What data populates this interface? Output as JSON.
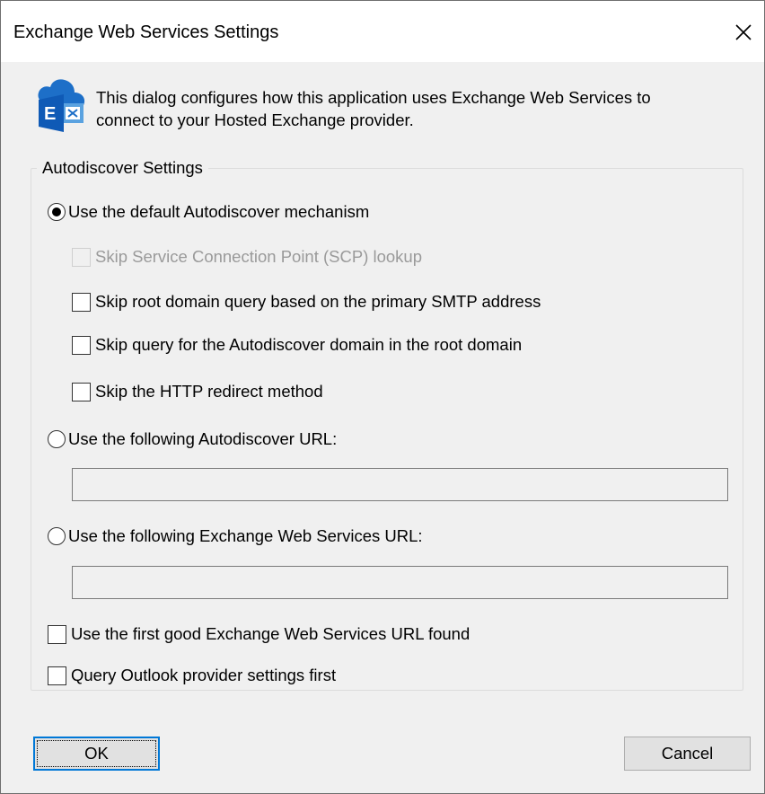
{
  "window": {
    "title": "Exchange Web Services Settings",
    "close_icon": "close-icon"
  },
  "info": {
    "icon": "exchange-icon",
    "line1": "This dialog configures how this application uses Exchange Web Services to",
    "line2": "connect to your Hosted Exchange provider."
  },
  "group": {
    "legend": "Autodiscover Settings",
    "radio_default": {
      "label": "Use the default Autodiscover mechanism",
      "checked": true
    },
    "checkboxes": [
      {
        "label": "Skip Service Connection Point (SCP) lookup",
        "checked": false,
        "disabled": true
      },
      {
        "label": "Skip root domain query based on the primary SMTP address",
        "checked": false,
        "disabled": false
      },
      {
        "label": "Skip query for the Autodiscover domain in the root domain",
        "checked": false,
        "disabled": false
      },
      {
        "label": "Skip the HTTP redirect method",
        "checked": false,
        "disabled": false
      }
    ],
    "radio_autodiscover_url": {
      "label": "Use the following Autodiscover URL:",
      "checked": false,
      "value": ""
    },
    "radio_ews_url": {
      "label": "Use the following Exchange Web Services URL:",
      "checked": false,
      "value": ""
    },
    "first_good": {
      "label": "Use the first good Exchange Web Services URL found",
      "checked": false
    },
    "outlook_first": {
      "label": "Query Outlook provider settings first",
      "checked": false
    }
  },
  "buttons": {
    "ok": "OK",
    "cancel": "Cancel"
  }
}
